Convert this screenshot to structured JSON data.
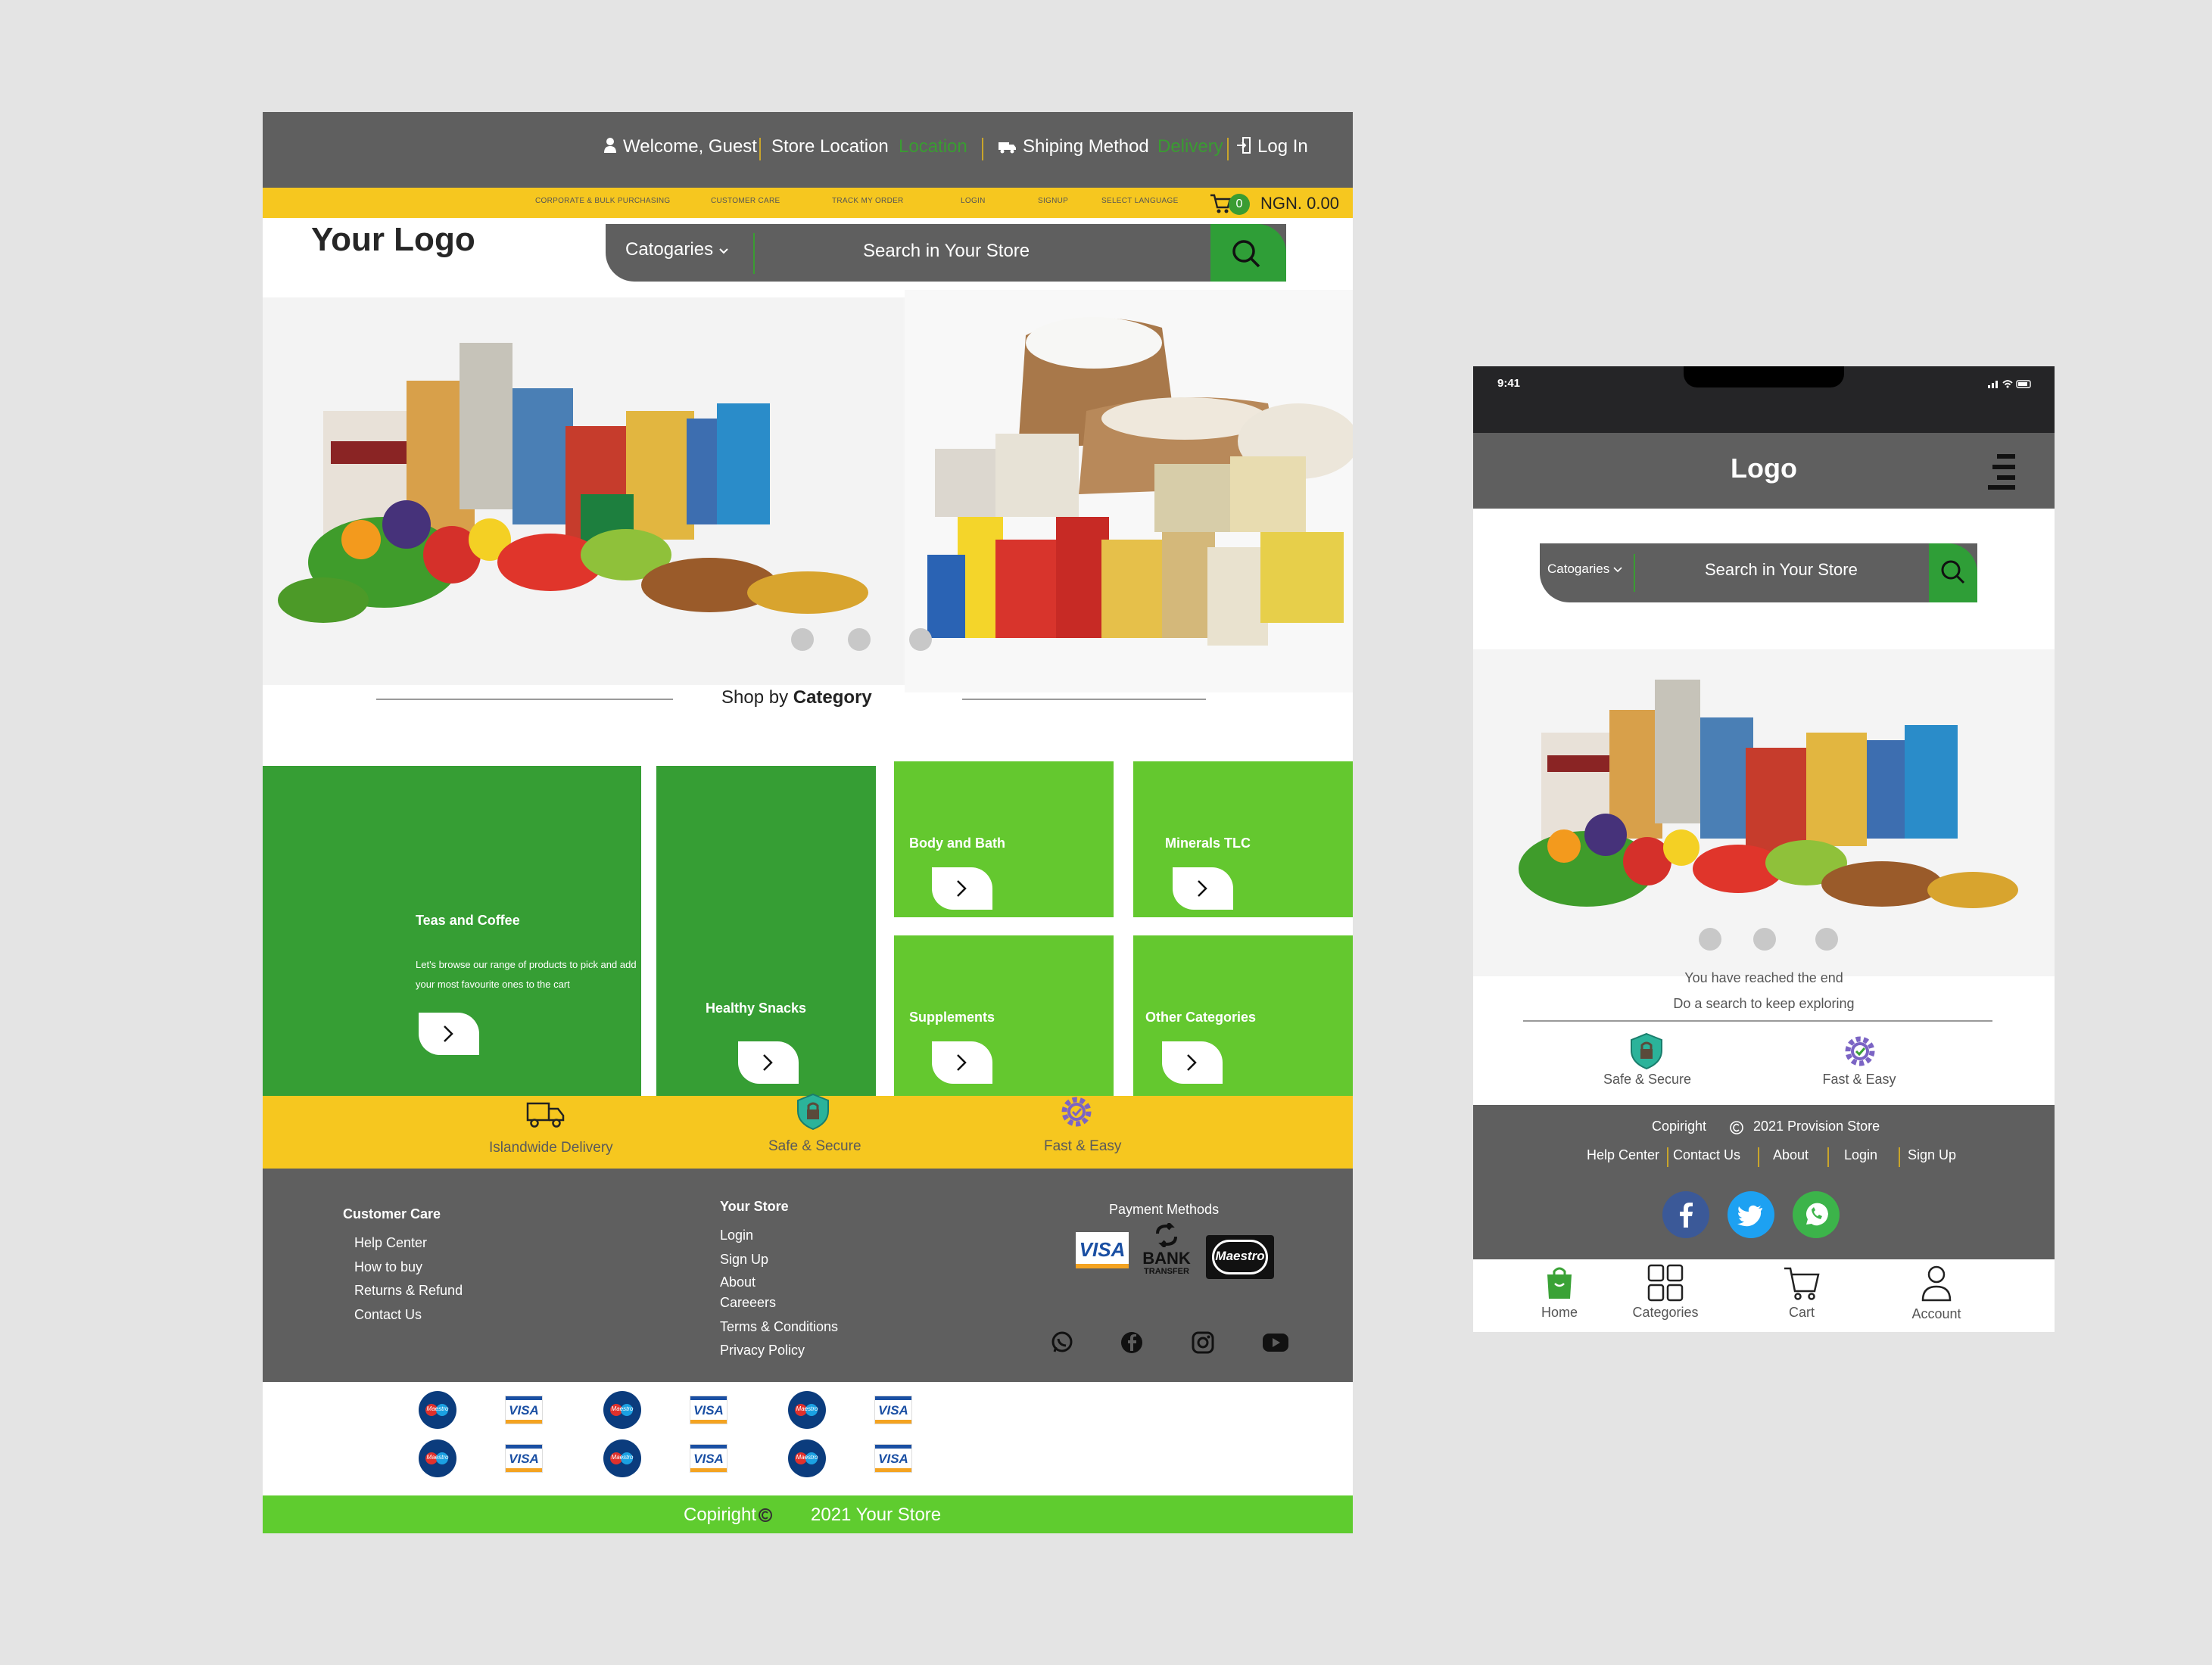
{
  "desktop": {
    "topbar": {
      "welcome": "Welcome, Guest",
      "store_location_label": "Store Location",
      "store_location_value": "Location",
      "shipping_label": "Shiping Method",
      "shipping_value": "Delivery",
      "login": "Log In"
    },
    "utility_links": [
      "CORPORATE & BULK PURCHASING",
      "CUSTOMER CARE",
      "TRACK MY ORDER",
      "LOGIN",
      "SIGNUP",
      "SELECT LANGUAGE"
    ],
    "cart": {
      "count": "0",
      "amount": "NGN. 0.00"
    },
    "logo": "Your Logo",
    "search": {
      "categories_label": "Catogaries",
      "placeholder": "Search in Your Store"
    },
    "shop_by": {
      "prefix": "Shop by",
      "emphasis": "Category"
    },
    "tiles": [
      {
        "title": "Teas and Coffee",
        "description": "Let's browse our range of products to pick and add your most favourite ones to the cart"
      },
      {
        "title": "Healthy Snacks"
      },
      {
        "title": "Body and Bath"
      },
      {
        "title": "Minerals TLC"
      },
      {
        "title": "Supplements"
      },
      {
        "title": "Other Categories"
      }
    ],
    "features": [
      "Islandwide Delivery",
      "Safe & Secure",
      "Fast & Easy"
    ],
    "footer": {
      "customer_care": {
        "heading": "Customer Care",
        "links": [
          "Help Center",
          "How to buy",
          "Returns & Refund",
          "Contact Us"
        ]
      },
      "your_store": {
        "heading": "Your Store",
        "links": [
          "Login",
          "Sign Up",
          "About",
          "Careeers",
          "Terms & Conditions",
          "Privacy Policy"
        ]
      },
      "payment": {
        "heading": "Payment Methods",
        "methods": [
          "VISA",
          "BANK",
          "TRANSFER",
          "Maestro"
        ]
      },
      "social_icons": [
        "whatsapp-icon",
        "facebook-icon",
        "instagram-icon",
        "youtube-icon"
      ]
    },
    "card_logos": {
      "maestro": "Maestro",
      "visa": "VISA"
    },
    "copyright": {
      "label": "Copiright",
      "text": "2021 Your Store"
    }
  },
  "mobile": {
    "status": {
      "time": "9:41"
    },
    "logo": "Logo",
    "search": {
      "categories_label": "Catogaries",
      "placeholder": "Search in Your Store"
    },
    "end_title": "You have reached the end",
    "end_subtitle": "Do a search to keep exploring",
    "features": [
      "Safe & Secure",
      "Fast & Easy"
    ],
    "footer": {
      "copyright_label": "Copiright",
      "copyright_text": "2021 Provision Store",
      "links": [
        "Help Center",
        "Contact Us",
        "About",
        "Login",
        "Sign Up"
      ]
    },
    "tabs": [
      "Home",
      "Categories",
      "Cart",
      "Account"
    ]
  },
  "colors": {
    "dark_gray": "#5f5f5f",
    "yellow": "#f6c71f",
    "dark_green": "#369e34",
    "light_green": "#64c82f",
    "bright_green": "#5fcc2f",
    "gear_purple": "#7b64c4"
  }
}
